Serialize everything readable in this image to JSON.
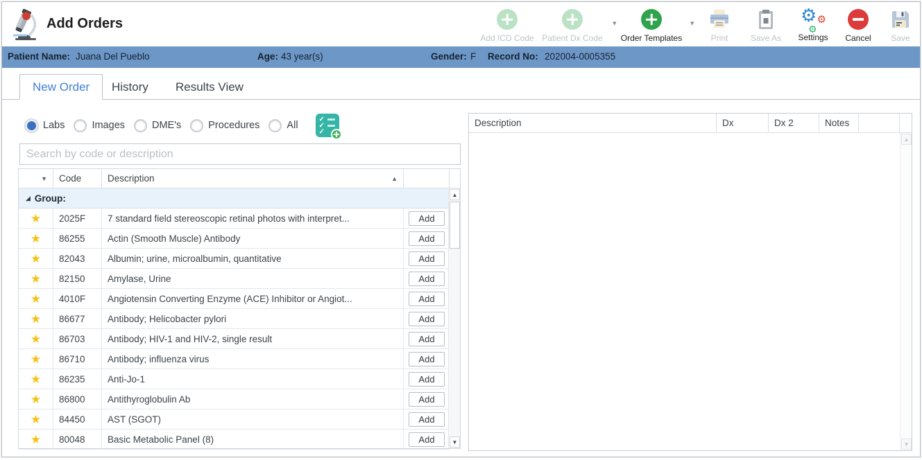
{
  "window": {
    "title": "Add Orders"
  },
  "toolbar": {
    "items": [
      {
        "label": "Add ICD Code",
        "icon": "plus-circle",
        "state": "disabled",
        "has_dropdown": false
      },
      {
        "label": "Patient Dx Code",
        "icon": "plus-circle",
        "state": "disabled",
        "has_dropdown": true
      },
      {
        "label": "Order Templates",
        "icon": "plus-circle",
        "state": "enabled",
        "has_dropdown": true
      },
      {
        "label": "Print",
        "icon": "printer",
        "state": "disabled",
        "has_dropdown": false
      },
      {
        "label": "Save As",
        "icon": "clipboard",
        "state": "disabled",
        "has_dropdown": false
      },
      {
        "label": "Settings",
        "icon": "gears",
        "state": "enabled",
        "has_dropdown": false
      },
      {
        "label": "Cancel",
        "icon": "no-entry",
        "state": "enabled",
        "has_dropdown": false
      },
      {
        "label": "Save",
        "icon": "floppy-disk",
        "state": "disabled",
        "has_dropdown": false
      }
    ]
  },
  "patient_bar": {
    "name_label": "Patient Name:",
    "name_value": "Juana Del Pueblo",
    "age_label": "Age:",
    "age_value": "43 year(s)",
    "gender_label": "Gender:",
    "gender_value": "F",
    "record_label": "Record No:",
    "record_value": "202004-0005355"
  },
  "tabs": [
    {
      "label": "New Order",
      "active": true
    },
    {
      "label": "History",
      "active": false
    },
    {
      "label": "Results View",
      "active": false
    }
  ],
  "filters": {
    "options": [
      {
        "label": "Labs",
        "selected": true
      },
      {
        "label": "Images",
        "selected": false
      },
      {
        "label": "DME's",
        "selected": false
      },
      {
        "label": "Procedures",
        "selected": false
      },
      {
        "label": "All",
        "selected": false
      }
    ]
  },
  "search": {
    "placeholder": "Search by code or description",
    "value": ""
  },
  "left_table": {
    "columns": {
      "code": "Code",
      "description": "Description"
    },
    "sort": {
      "column": "Description",
      "direction": "asc"
    },
    "group_label": "Group:",
    "add_button_label": "Add",
    "rows": [
      {
        "code": "2025F",
        "description": "7 standard field stereoscopic retinal photos with interpret..."
      },
      {
        "code": "86255",
        "description": "Actin (Smooth Muscle) Antibody"
      },
      {
        "code": "82043",
        "description": "Albumin; urine, microalbumin, quantitative"
      },
      {
        "code": "82150",
        "description": "Amylase, Urine"
      },
      {
        "code": "4010F",
        "description": "Angiotensin Converting Enzyme (ACE) Inhibitor or Angiot..."
      },
      {
        "code": "86677",
        "description": "Antibody; Helicobacter pylori"
      },
      {
        "code": "86703",
        "description": "Antibody; HIV-1 and HIV-2, single result"
      },
      {
        "code": "86710",
        "description": "Antibody; influenza virus"
      },
      {
        "code": "86235",
        "description": "Anti-Jo-1"
      },
      {
        "code": "86800",
        "description": "Antithyroglobulin Ab"
      },
      {
        "code": "84450",
        "description": "AST (SGOT)"
      },
      {
        "code": "80048",
        "description": "Basic Metabolic Panel (8)"
      }
    ]
  },
  "order_list": {
    "columns": [
      "Description",
      "Dx",
      "Dx 2",
      "Notes"
    ],
    "rows": []
  },
  "colors": {
    "patient_bar_blue": "#6d97c7",
    "active_tab_blue": "#3f80d8",
    "enabled_plus_green": "#2fa44c",
    "disabled_plus_green": "#bce2c6",
    "cancel_red": "#dd3b3b",
    "star_gold": "#f5c217",
    "checklist_teal": "#35b5a5",
    "group_row_blue": "#e8f2fb",
    "radio_selected_blue": "#3b6fc0"
  }
}
